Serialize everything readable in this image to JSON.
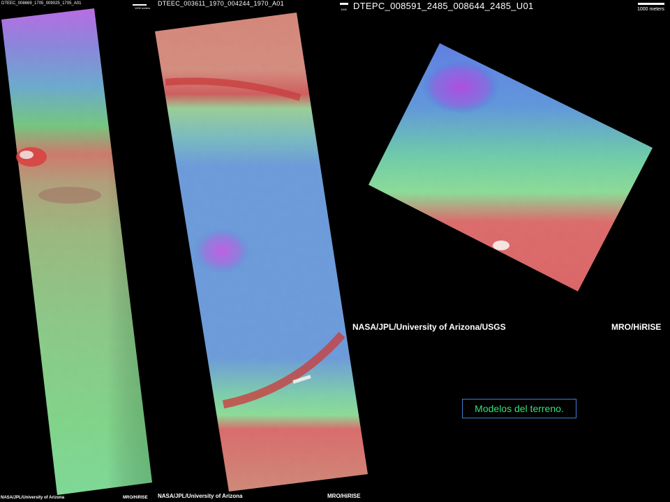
{
  "strips": [
    {
      "title": "DTEEC_008669_1705_009025_1705_A01",
      "scale_label": "1000 meters"
    },
    {
      "title": "DTEEC_003611_1970_004244_1970_A01",
      "scale_label": "1000 meters"
    },
    {
      "title": "DTEPC_008591_2485_008644_2485_U01",
      "scale_label": "1000 meters",
      "scale_label_small": "1000"
    }
  ],
  "credits": {
    "strip1_left": "NASA/JPL/University of Arizona",
    "strip1_right": "MRO/HiRISE",
    "strip2_left": "NASA/JPL/University of Arizona",
    "strip2_right": "MRO/HiRISE",
    "main_left": "NASA/JPL/University of Arizona/USGS",
    "main_right": "MRO/HiRISE"
  },
  "caption": "Modelos del terreno.",
  "colors": {
    "background": "#000000",
    "caption_text": "#2fe37c",
    "caption_border": "#3d7fd1"
  }
}
